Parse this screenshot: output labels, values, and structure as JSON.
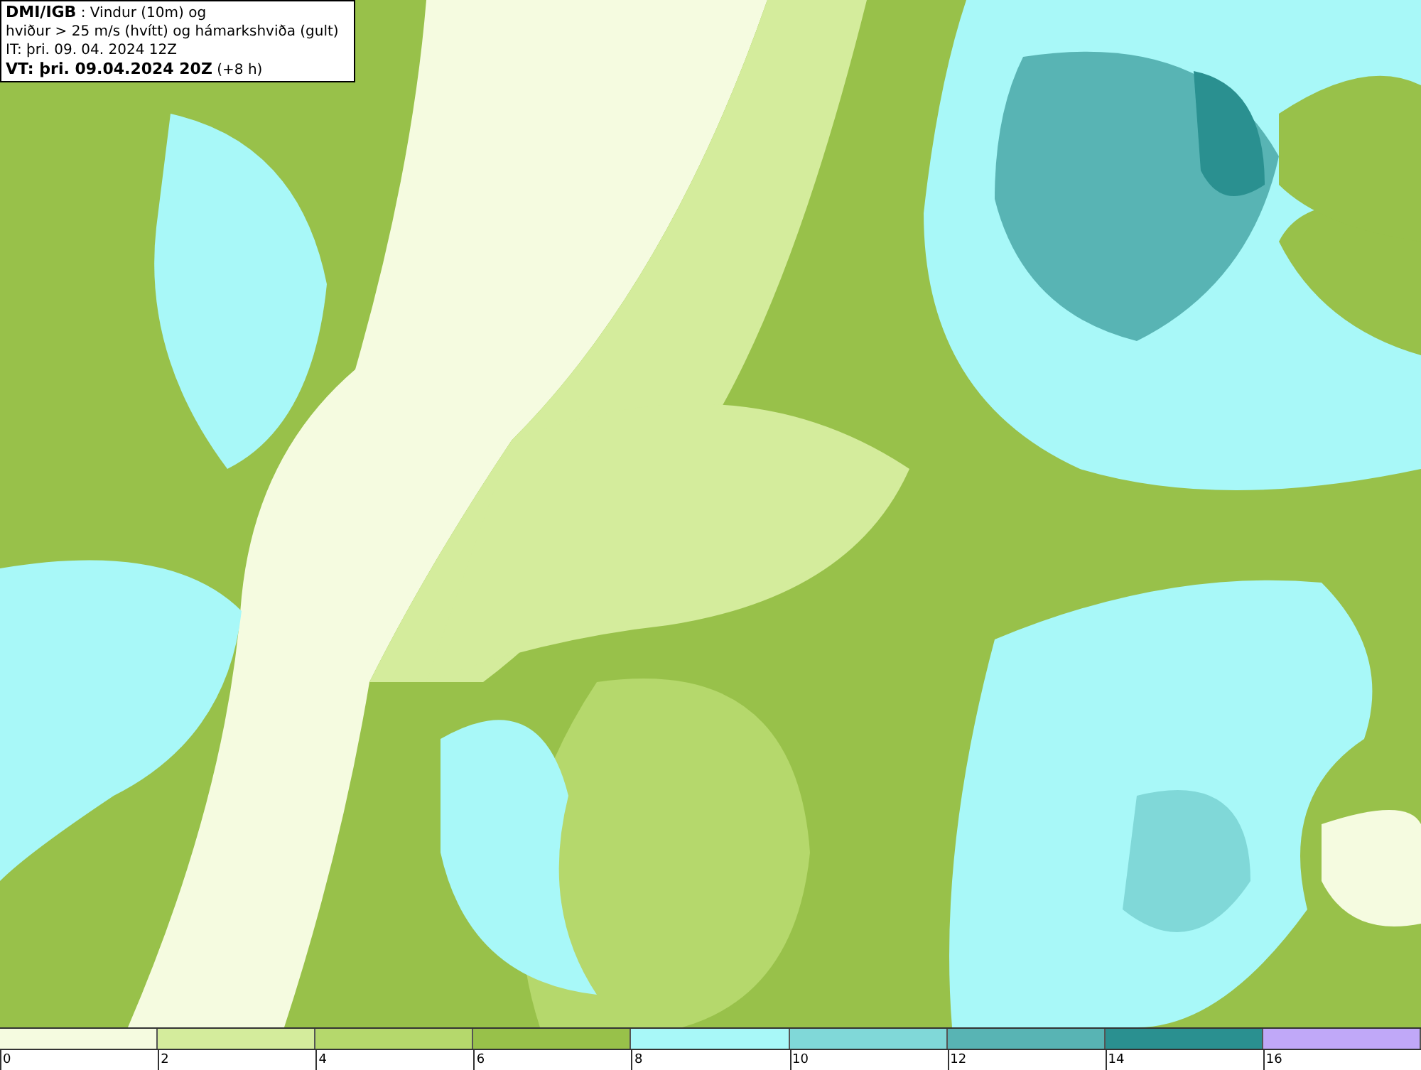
{
  "info_box": {
    "lines": [
      "**DMI/IGB** : Vindur (10m) og",
      "hviður > 25 m/s (hvítt) og hámarkshviða (gult)",
      "IT: þri. 09. 04. 2024 12Z",
      "**VT: þri. 09.04.2024 20Z** (+8 h)"
    ]
  },
  "legend": {
    "bins": [
      {
        "color": "#f5fbe0"
      },
      {
        "color": "#d4ec9c"
      },
      {
        "color": "#b5d86c"
      },
      {
        "color": "#98c14a"
      },
      {
        "color": "#a8f8f8"
      },
      {
        "color": "#80d8d8"
      },
      {
        "color": "#58b4b4"
      },
      {
        "color": "#2a9090"
      },
      {
        "color": "#c0a8f8"
      }
    ],
    "ticks": [
      "0",
      "2",
      "4",
      "6",
      "8",
      "10",
      "12",
      "14",
      "16"
    ]
  }
}
